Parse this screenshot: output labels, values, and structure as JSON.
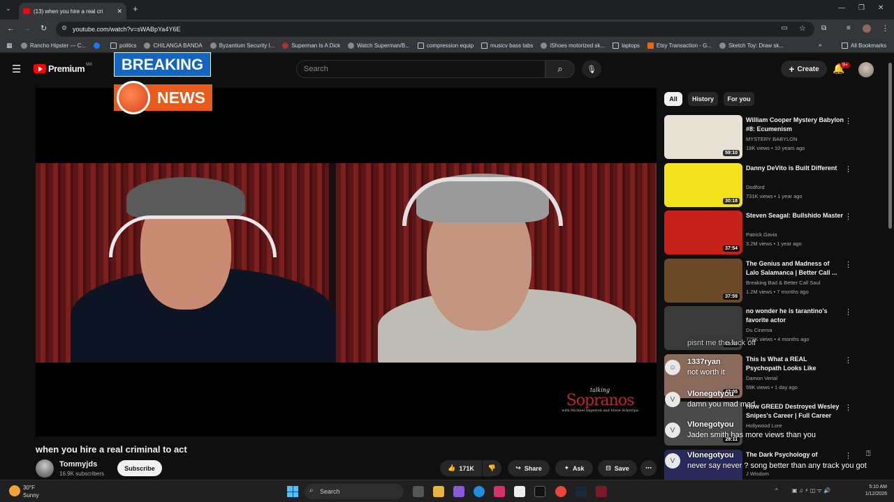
{
  "browser": {
    "tab_title": "(13) when you hire a real cri",
    "url": "youtube.com/watch?v=sWABpYa4Y6E",
    "bookmarks": [
      "Rancho Hipster — C...",
      "politics",
      "CHILANGA BANDA",
      "Byzantium Security I...",
      "Superman Is A Dick",
      "Watch Superman/B...",
      "compression equip",
      "musicv bass tabs",
      "iShoes motorized sk...",
      "laptops",
      "Etsy Transaction - G...",
      "Sketch Toy: Draw sk..."
    ],
    "all_bookmarks": "All Bookmarks"
  },
  "youtube": {
    "logo": "Premium",
    "region": "MX",
    "search_placeholder": "Search",
    "create": "Create",
    "notif_count": "9+"
  },
  "overlay": {
    "breaking": "BREAKING",
    "news": "NEWS"
  },
  "watermark": {
    "small": "talking",
    "big": "Sopranos",
    "names": "with Michael Imperioli and Steve Schirripa"
  },
  "video": {
    "title": "when you hire a real criminal to act",
    "channel": "Tommyjds",
    "subscribers": "16.9K subscribers",
    "subscribe": "Subscribe",
    "likes": "171K",
    "share": "Share",
    "ask": "Ask",
    "save": "Save"
  },
  "chips": [
    "All",
    "History",
    "For you"
  ],
  "recommendations": [
    {
      "title": "William Cooper  Mystery Babylon #8:  Ecumenism",
      "channel": "MYSTERY BABYLON",
      "meta": "19K views • 10 years ago",
      "duration": "59:10",
      "thumb_color": "#e8e2d6"
    },
    {
      "title": "Danny DeVito is Built Different",
      "channel": "Dodford",
      "meta": "731K views • 1 year ago",
      "duration": "30:18",
      "thumb_color": "#f2e31d"
    },
    {
      "title": "Steven Seagal: Bullshido Master",
      "channel": "Patrick Gavia",
      "meta": "3.2M views • 1 year ago",
      "duration": "37:54",
      "thumb_color": "#c7221a"
    },
    {
      "title": "The Genius and Madness of Lalo Salamanca | Better Call ...",
      "channel": "Breaking Bad & Better Call Saul",
      "meta": "1.2M views • 7 months ago",
      "duration": "37:59",
      "thumb_color": "#6b4a2a"
    },
    {
      "title": "no wonder he is tarantino's favorite actor",
      "channel": "Du Cinema",
      "meta": "729K views • 4 months ago",
      "duration": "15:49",
      "thumb_color": "#3a3a3a"
    },
    {
      "title": "This Is What a REAL Psychopath Looks Like",
      "channel": "Damon Verial",
      "meta": "59K views • 1 day ago",
      "duration": "47:05",
      "thumb_color": "#8a6a5a"
    },
    {
      "title": "How GREED Destroyed Wesley Snipes's Career | Full Career",
      "channel": "Hollywood Lore",
      "meta": "",
      "duration": "28:11",
      "thumb_color": "#4a4a4a"
    },
    {
      "title": "The Dark Psychology of",
      "channel": "J Wisdom",
      "meta": "",
      "duration": "",
      "thumb_color": "#2a2a5a"
    }
  ],
  "chat": [
    {
      "user": "",
      "text": "pisnt me the fuck off"
    },
    {
      "user": "1337ryan",
      "text": "not worth it"
    },
    {
      "user": "Vlonegotyou",
      "text": "damn you mad mad"
    },
    {
      "user": "Vlonegotyou",
      "text": "Jaden smith has more views than you"
    },
    {
      "user": "Vlonegotyou",
      "text": "never say never ? song better than any track you got"
    }
  ],
  "taskbar": {
    "temp": "30°F",
    "weather": "Sunny",
    "search": "Search",
    "time": "5:10 AM",
    "date": "1/12/2026"
  }
}
